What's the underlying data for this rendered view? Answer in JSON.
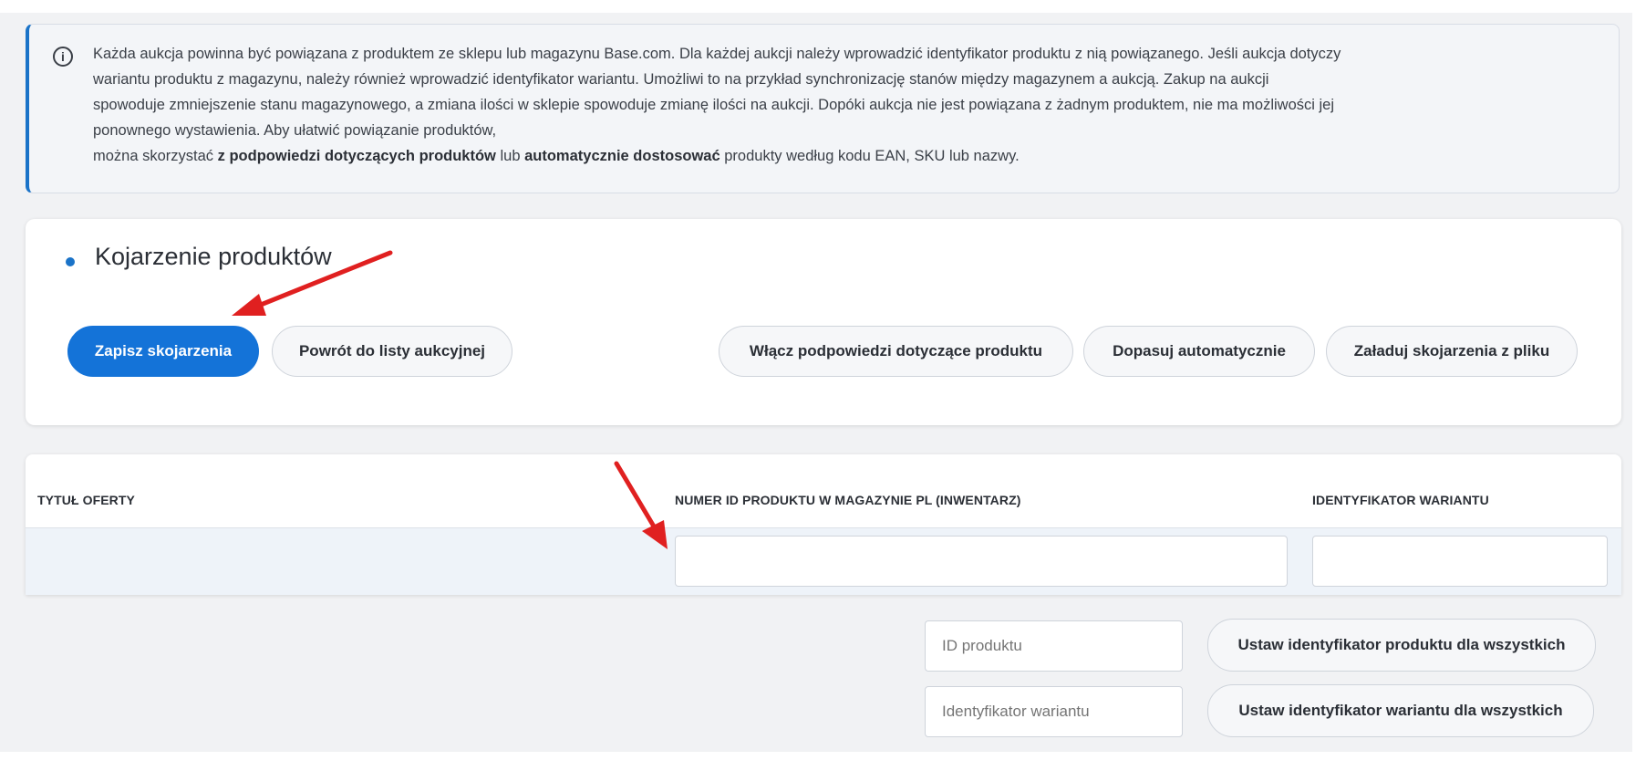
{
  "info": {
    "line1": "Każda aukcja powinna być powiązana z produktem ze sklepu lub magazynu Base.com. Dla każdej aukcji należy wprowadzić identyfikator produktu z nią powiązanego. Jeśli aukcja dotyczy",
    "line2": "wariantu produktu z magazynu, należy również wprowadzić identyfikator wariantu. Umożliwi to na przykład synchronizację stanów między magazynem a aukcją. Zakup na aukcji",
    "line3": "spowoduje zmniejszenie stanu magazynowego, a zmiana ilości w sklepie spowoduje zmianę ilości na aukcji. Dopóki aukcja nie jest powiązana z żadnym produktem, nie ma możliwości jej",
    "line4": "ponownego wystawienia. Aby ułatwić powiązanie produktów,",
    "line5_pre": "można skorzystać ",
    "line5_bold1": "z podpowiedzi dotyczących produktów",
    "line5_mid": " lub ",
    "line5_bold2": "automatycznie dostosować",
    "line5_post": " produkty według kodu EAN, SKU lub nazwy."
  },
  "section": {
    "title": "Kojarzenie produktów"
  },
  "buttons": {
    "save": "Zapisz skojarzenia",
    "back": "Powrót do listy aukcyjnej",
    "hints": "Włącz podpowiedzi dotyczące produktu",
    "auto": "Dopasuj automatycznie",
    "load": "Załaduj skojarzenia z pliku",
    "set_product_all": "Ustaw identyfikator produktu dla wszystkich",
    "set_variant_all": "Ustaw identyfikator wariantu dla wszystkich"
  },
  "table": {
    "col_title": "TYTUŁ OFERTY",
    "col_product_id": "NUMER ID PRODUKTU W MAGAZYNIE PL (INWENTARZ)",
    "col_variant_id": "IDENTYFIKATOR WARIANTU"
  },
  "bulk": {
    "product_placeholder": "ID produktu",
    "variant_placeholder": "Identyfikator wariantu"
  },
  "colors": {
    "accent": "#1473d8",
    "annotation_arrow": "#e02020"
  },
  "icons": {
    "info": "info-circle-icon"
  }
}
